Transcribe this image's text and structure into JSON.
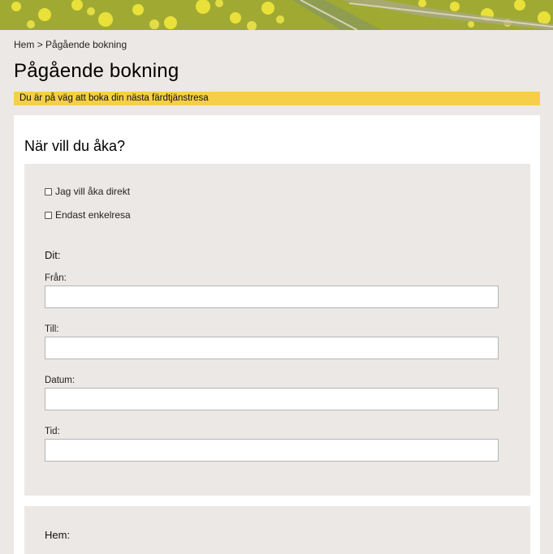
{
  "banner": {
    "description_icon": "field-banner-image"
  },
  "breadcrumb": {
    "home": "Hem",
    "separator": ">",
    "current": "Pågående bokning"
  },
  "page": {
    "title": "Pågående bokning"
  },
  "notice": {
    "text": "Du är på väg att boka din nästa färdtjänstresa"
  },
  "booking": {
    "title": "När vill du åka?",
    "options": [
      {
        "label": "Jag vill åka direkt",
        "checked": false
      },
      {
        "label": "Endast enkelresa",
        "checked": false
      }
    ],
    "outbound": {
      "heading": "Dit:",
      "fields": [
        {
          "label": "Från:",
          "value": ""
        },
        {
          "label": "Till:",
          "value": ""
        },
        {
          "label": "Datum:",
          "value": ""
        },
        {
          "label": "Tid:",
          "value": ""
        }
      ]
    },
    "return": {
      "heading": "Hem:"
    }
  },
  "colors": {
    "notice_bg": "#f5cf47",
    "page_bg": "#ece8e6",
    "card_bg": "#ffffff"
  }
}
